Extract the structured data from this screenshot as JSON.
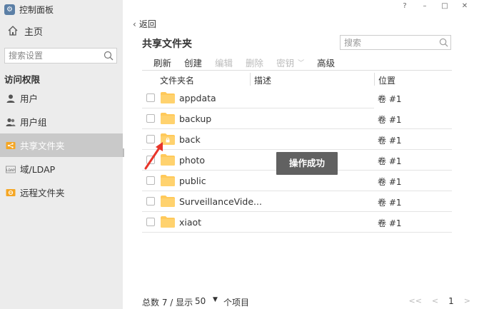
{
  "app": {
    "title": "控制面板",
    "logo": "gear-icon"
  },
  "window_controls": [
    "?",
    "–",
    "□",
    "✕"
  ],
  "sidebar": {
    "home_label": "主页",
    "search_placeholder": "搜索设置",
    "section_title": "访问权限",
    "items": [
      {
        "label": "用户",
        "icon": "user-icon",
        "active": false
      },
      {
        "label": "用户组",
        "icon": "user-group-icon",
        "active": false
      },
      {
        "label": "共享文件夹",
        "icon": "share-icon",
        "active": true
      },
      {
        "label": "域/LDAP",
        "icon": "ldap-icon",
        "active": false
      },
      {
        "label": "远程文件夹",
        "icon": "remote-folder-icon",
        "active": false
      }
    ]
  },
  "main": {
    "back_label": "返回",
    "title": "共享文件夹",
    "search_placeholder": "搜索",
    "toolbar": {
      "refresh": "刷新",
      "create": "创建",
      "edit": "编辑",
      "delete": "删除",
      "encrypt": "密钥",
      "advanced": "高级"
    },
    "columns": {
      "name": "文件夹名",
      "description": "描述",
      "location": "位置"
    },
    "rows": [
      {
        "name": "appdata",
        "description": "",
        "location": "卷 #1",
        "locked": false
      },
      {
        "name": "backup",
        "description": "",
        "location": "卷 #1",
        "locked": false
      },
      {
        "name": "back",
        "description": "",
        "location": "卷 #1",
        "locked": true
      },
      {
        "name": "photo",
        "description": "",
        "location": "卷 #1",
        "locked": false
      },
      {
        "name": "public",
        "description": "",
        "location": "卷 #1",
        "locked": false
      },
      {
        "name": "SurveillanceVide...",
        "description": "",
        "location": "卷 #1",
        "locked": false
      },
      {
        "name": "xiaot",
        "description": "",
        "location": "卷 #1",
        "locked": false
      }
    ],
    "toast": "操作成功"
  },
  "footer": {
    "total_label": "总数 7 / 显示",
    "page_size": "50",
    "items_label": "个项目",
    "pager": {
      "first": "<<",
      "prev": "<",
      "current": "1",
      "next": ">"
    }
  },
  "colors": {
    "sidebar_bg": "#ececec",
    "active_bg": "#c9c9c9",
    "folder": "#ffc95a",
    "toast_bg": "#616161",
    "arrow": "#e8352a"
  }
}
